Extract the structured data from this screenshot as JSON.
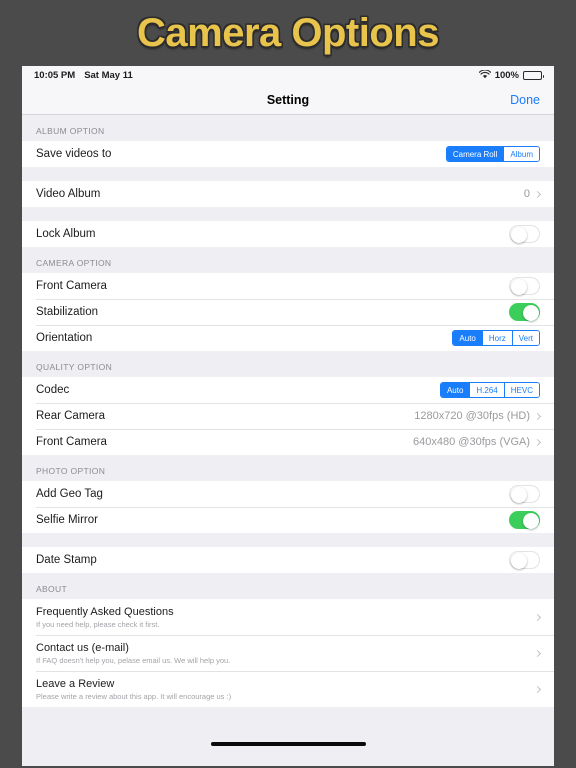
{
  "banner": {
    "title": "Camera Options",
    "title_color": "#e9c44c"
  },
  "statusbar": {
    "time": "10:05 PM",
    "date": "Sat May 11",
    "wifi_icon": "wifi-icon",
    "battery_percent": "100%",
    "battery_icon": "battery-full-icon"
  },
  "navbar": {
    "title": "Setting",
    "done_label": "Done"
  },
  "accent_color": "#1a7dfa",
  "toggle_on_color": "#3cce5b",
  "sections": [
    {
      "header": "ALBUM OPTION",
      "groups": [
        {
          "rows": [
            {
              "label": "Save videos to",
              "control": "segmented",
              "options": [
                "Camera Roll",
                "Album"
              ],
              "selected": "Camera Roll"
            }
          ]
        },
        {
          "rows": [
            {
              "label": "Video Album",
              "control": "value-chevron",
              "value": "0"
            }
          ]
        },
        {
          "rows": [
            {
              "label": "Lock Album",
              "control": "toggle",
              "state": "off"
            }
          ]
        }
      ]
    },
    {
      "header": "CAMERA OPTION",
      "groups": [
        {
          "rows": [
            {
              "label": "Front Camera",
              "control": "toggle",
              "state": "off"
            },
            {
              "label": "Stabilization",
              "control": "toggle",
              "state": "on"
            },
            {
              "label": "Orientation",
              "control": "segmented",
              "options": [
                "Auto",
                "Horz",
                "Vert"
              ],
              "selected": "Auto"
            }
          ]
        }
      ]
    },
    {
      "header": "QUALITY OPTION",
      "groups": [
        {
          "rows": [
            {
              "label": "Codec",
              "control": "segmented",
              "options": [
                "Auto",
                "H.264",
                "HEVC"
              ],
              "selected": "Auto"
            },
            {
              "label": "Rear Camera",
              "control": "value-chevron",
              "value": "1280x720 @30fps (HD)"
            },
            {
              "label": "Front Camera",
              "control": "value-chevron",
              "value": "640x480 @30fps (VGA)"
            }
          ]
        }
      ]
    },
    {
      "header": "PHOTO OPTION",
      "groups": [
        {
          "rows": [
            {
              "label": "Add Geo Tag",
              "control": "toggle",
              "state": "off"
            },
            {
              "label": "Selfie Mirror",
              "control": "toggle",
              "state": "on"
            }
          ]
        },
        {
          "rows": [
            {
              "label": "Date Stamp",
              "control": "toggle",
              "state": "off"
            }
          ]
        }
      ]
    },
    {
      "header": "ABOUT",
      "groups": [
        {
          "rows": [
            {
              "label": "Frequently Asked Questions",
              "subtitle": "If you need help, please check it first.",
              "control": "chevron"
            },
            {
              "label": "Contact us (e-mail)",
              "subtitle": "If FAQ doesn't help you, pelase email us. We will help you.",
              "control": "chevron"
            },
            {
              "label": "Leave a Review",
              "subtitle": "Please write a review about this app. It will encourage us :)",
              "control": "chevron"
            }
          ]
        }
      ]
    }
  ]
}
